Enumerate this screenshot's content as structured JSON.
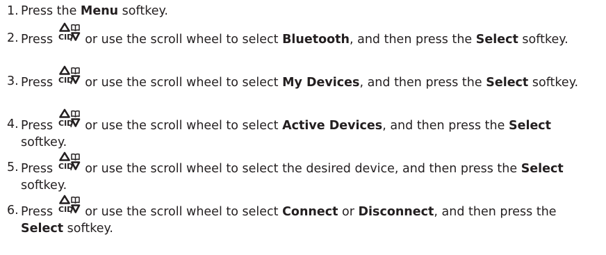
{
  "instructions": {
    "steps": [
      {
        "number": "1.",
        "segments": [
          {
            "text": "Press the ",
            "bold": false
          },
          {
            "text": "Menu",
            "bold": true
          },
          {
            "text": " softkey.",
            "bold": false
          }
        ]
      },
      {
        "number": "2.",
        "segments": [
          {
            "text": "Press ",
            "bold": false
          },
          {
            "icon": "up-cid-down-phonebook-key-icon"
          },
          {
            "text": " or use the scroll wheel to select ",
            "bold": false
          },
          {
            "text": "Bluetooth",
            "bold": true
          },
          {
            "text": ", and then press the ",
            "bold": false
          },
          {
            "text": "Select",
            "bold": true
          },
          {
            "text": " softkey.",
            "bold": false
          }
        ]
      },
      {
        "number": "3.",
        "segments": [
          {
            "text": "Press ",
            "bold": false
          },
          {
            "icon": "up-cid-down-phonebook-key-icon"
          },
          {
            "text": " or use the scroll wheel to select ",
            "bold": false
          },
          {
            "text": "My Devices",
            "bold": true
          },
          {
            "text": ", and then press the ",
            "bold": false
          },
          {
            "text": "Select",
            "bold": true
          },
          {
            "text": " softkey.",
            "bold": false
          }
        ]
      },
      {
        "number": "4.",
        "segments": [
          {
            "text": "Press ",
            "bold": false
          },
          {
            "icon": "up-cid-down-phonebook-key-icon"
          },
          {
            "text": " or use the scroll wheel to select ",
            "bold": false
          },
          {
            "text": "Active Devices",
            "bold": true
          },
          {
            "text": ", and then press the ",
            "bold": false
          },
          {
            "text": "Select",
            "bold": true
          },
          {
            "text": " softkey.",
            "bold": false
          }
        ]
      },
      {
        "number": "5.",
        "segments": [
          {
            "text": "Press ",
            "bold": false
          },
          {
            "icon": "up-cid-down-phonebook-key-icon"
          },
          {
            "text": " or use the scroll wheel to select the desired device, and then press the ",
            "bold": false
          },
          {
            "text": "Select",
            "bold": true
          },
          {
            "text": " softkey.",
            "bold": false
          }
        ]
      },
      {
        "number": "6.",
        "segments": [
          {
            "text": "Press ",
            "bold": false
          },
          {
            "icon": "up-cid-down-phonebook-key-icon"
          },
          {
            "text": " or use the scroll wheel to select ",
            "bold": false
          },
          {
            "text": "Connect",
            "bold": true
          },
          {
            "text": " or ",
            "bold": false
          },
          {
            "text": "Disconnect",
            "bold": true
          },
          {
            "text": ", and then press the ",
            "bold": false
          },
          {
            "text": "Select",
            "bold": true
          },
          {
            "text": " softkey.",
            "bold": false
          }
        ]
      }
    ],
    "key_glyph": {
      "label": "CID",
      "icon": "up-cid-down-phonebook-key-icon"
    },
    "colors": {
      "text": "#231f20",
      "background": "#ffffff"
    }
  }
}
